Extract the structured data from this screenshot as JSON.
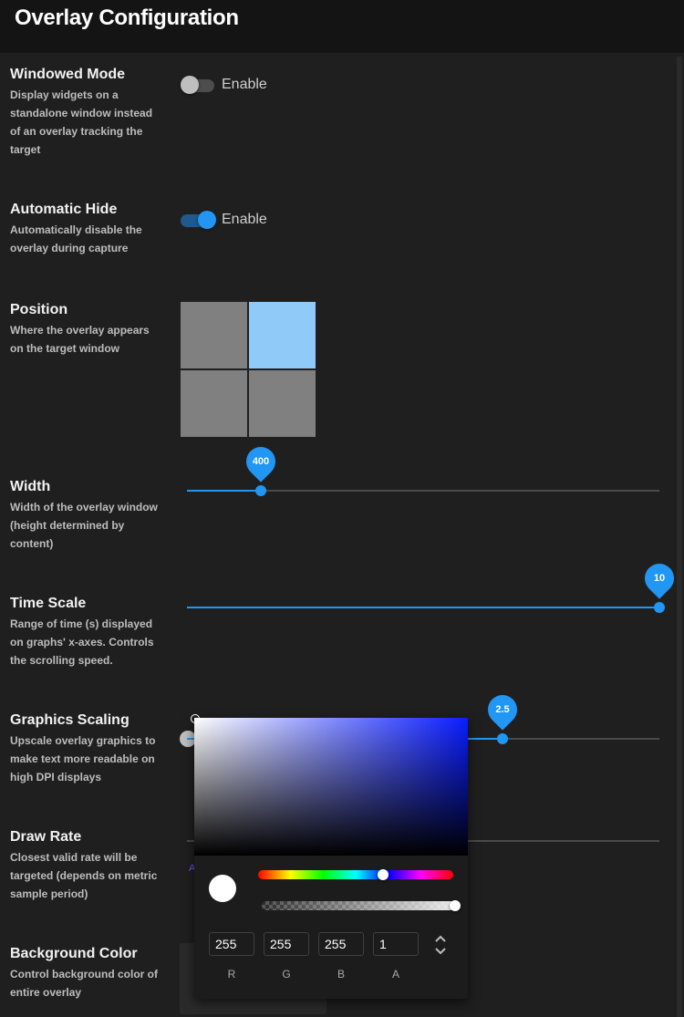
{
  "header": {
    "title": "Overlay Configuration"
  },
  "settings": {
    "windowed_mode": {
      "name": "Windowed Mode",
      "desc": [
        "Display widgets on a",
        "standalone window instead",
        "of an overlay tracking the",
        "target"
      ],
      "toggle_label": "Enable",
      "enabled": false
    },
    "automatic_hide": {
      "name": "Automatic Hide",
      "desc": [
        "Automatically disable the",
        "overlay during capture"
      ],
      "toggle_label": "Enable",
      "enabled": true
    },
    "position": {
      "name": "Position",
      "desc": [
        "Where the overlay appears",
        "on the target window"
      ],
      "selected": "top-right"
    },
    "width": {
      "name": "Width",
      "desc": [
        "Width of the overlay window",
        "(height determined by",
        "content)"
      ],
      "value": "400",
      "fraction": 0.157
    },
    "time_scale": {
      "name": "Time Scale",
      "desc": [
        "Range of time (s) displayed",
        "on graphs' x-axes. Controls",
        "the scrolling speed."
      ],
      "value": "10",
      "fraction": 1.0
    },
    "graphics_scaling": {
      "name": "Graphics Scaling",
      "desc": [
        "Upscale overlay graphics to",
        "make text more readable on",
        "high DPI displays"
      ],
      "value": "2.5",
      "fraction": 0.667
    },
    "draw_rate": {
      "name": "Draw Rate",
      "desc": [
        "Closest valid rate will be",
        "targeted (depends on metric",
        "sample period)"
      ],
      "mark_glyph": "A"
    },
    "background_color": {
      "name": "Background Color",
      "desc": [
        "Control background color of",
        "entire overlay"
      ]
    }
  },
  "color_picker": {
    "base_hue_color": "#0a1dff",
    "hue_fraction": 0.64,
    "alpha_fraction": 1.0,
    "r": "255",
    "g": "255",
    "b": "255",
    "a": "1",
    "labels": {
      "r": "R",
      "g": "G",
      "b": "B",
      "a": "A"
    },
    "icons": {
      "format_toggle": "unfold-icon"
    }
  },
  "colors": {
    "accent": "#2196f3",
    "position_active": "#90caf9",
    "position_inactive": "#808080"
  }
}
